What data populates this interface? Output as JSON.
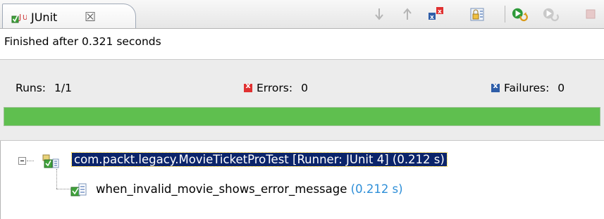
{
  "tab": {
    "title": "JUnit",
    "close": "☒"
  },
  "toolbar": {
    "icons": [
      "next-failure-icon",
      "previous-failure-icon",
      "show-failures-only-icon",
      "scroll-lock-icon",
      "rerun-test-icon",
      "rerun-failed-first-icon",
      "stop-icon"
    ]
  },
  "status": {
    "text": "Finished after 0.321 seconds"
  },
  "counters": {
    "runs_label": "Runs:",
    "runs_value": "1/1",
    "errors_label": "Errors:",
    "errors_value": "0",
    "failures_label": "Failures:",
    "failures_value": "0"
  },
  "progress": {
    "fraction": 1.0,
    "color": "#5fbf4f"
  },
  "tree": {
    "root": {
      "label": "com.packt.legacy.MovieTicketProTest [Runner: JUnit 4] (0.212 s)",
      "selected": true
    },
    "children": [
      {
        "name": "when_invalid_movie_shows_error_message",
        "time": "(0.212 s)"
      }
    ]
  }
}
